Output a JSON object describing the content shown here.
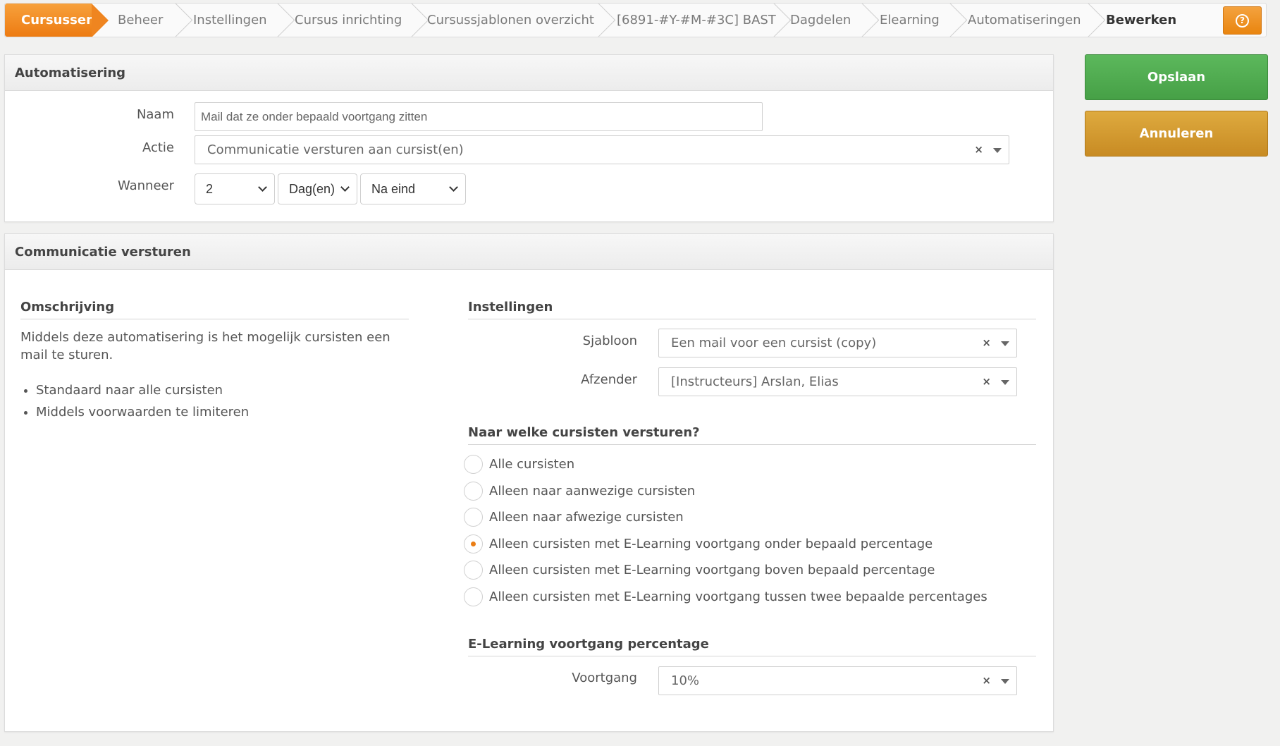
{
  "breadcrumb": {
    "items": [
      "Cursussen",
      "Beheer",
      "Instellingen",
      "Cursus inrichting",
      "Cursussjablonen overzicht",
      "[6891-#Y-#M-#3C] BAST",
      "Dagdelen",
      "Elearning",
      "Automatiseringen",
      "Bewerken"
    ],
    "help_icon": "question-circle-icon"
  },
  "actions": {
    "save_label": "Opslaan",
    "cancel_label": "Annuleren"
  },
  "automatisering": {
    "title": "Automatisering",
    "naam_label": "Naam",
    "naam_value": "Mail dat ze onder bepaald voortgang zitten",
    "actie_label": "Actie",
    "actie_value": "Communicatie versturen aan cursist(en)",
    "wanneer_label": "Wanneer",
    "wanneer_number": "2",
    "wanneer_unit": "Dag(en)",
    "wanneer_moment": "Na eind"
  },
  "communicatie": {
    "title": "Communicatie versturen",
    "omschrijving_title": "Omschrijving",
    "omschrijving_text": "Middels deze automatisering is het mogelijk cursisten een mail te sturen.",
    "bullets": [
      "Standaard naar alle cursisten",
      "Middels voorwaarden te limiteren"
    ],
    "instellingen_title": "Instellingen",
    "sjabloon_label": "Sjabloon",
    "sjabloon_value": "Een mail voor een cursist (copy)",
    "afzender_label": "Afzender",
    "afzender_value": "[Instructeurs] Arslan, Elias",
    "recipients_title": "Naar welke cursisten versturen?",
    "recipient_options": [
      {
        "label": "Alle cursisten",
        "checked": false
      },
      {
        "label": "Alleen naar aanwezige cursisten",
        "checked": false
      },
      {
        "label": "Alleen naar afwezige cursisten",
        "checked": false
      },
      {
        "label": "Alleen cursisten met E-Learning voortgang onder bepaald percentage",
        "checked": true
      },
      {
        "label": "Alleen cursisten met E-Learning voortgang boven bepaald percentage",
        "checked": false
      },
      {
        "label": "Alleen cursisten met E-Learning voortgang tussen twee bepaalde percentages",
        "checked": false
      }
    ],
    "percentage_title": "E-Learning voortgang percentage",
    "voortgang_label": "Voortgang",
    "voortgang_value": "10%"
  },
  "colors": {
    "accent_orange": "#ed7b12",
    "save_green": "#5cb85c",
    "cancel_gold": "#c88b23"
  }
}
